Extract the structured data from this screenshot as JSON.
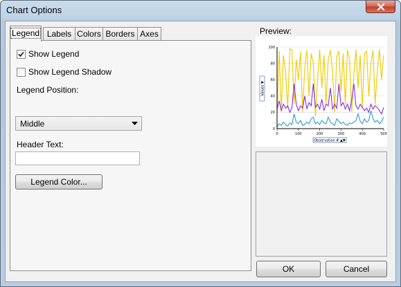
{
  "window": {
    "title": "Chart Options"
  },
  "tabs": [
    {
      "label": "Legend",
      "active": true
    },
    {
      "label": "Labels",
      "active": false
    },
    {
      "label": "Colors",
      "active": false
    },
    {
      "label": "Borders",
      "active": false
    },
    {
      "label": "Axes",
      "active": false
    }
  ],
  "legend_panel": {
    "show_legend": {
      "label": "Show Legend",
      "checked": true
    },
    "show_legend_shadow": {
      "label": "Show Legend Shadow",
      "checked": false
    },
    "position_label": "Legend Position:",
    "position_value": "Middle",
    "header_label": "Header Text:",
    "header_value": "",
    "color_button": "Legend Color..."
  },
  "preview": {
    "label": "Preview:",
    "chart_data": {
      "type": "line",
      "title": "",
      "xlabel": "Observation #",
      "ylabel": "Values",
      "x_ticks": [
        "0",
        "100",
        "200",
        "300",
        "400",
        "500"
      ],
      "y_ticks": [
        "0",
        "20",
        "40",
        "60",
        "80",
        "100"
      ],
      "xlim": [
        0,
        500
      ],
      "ylim": [
        0,
        100
      ],
      "series": [
        {
          "color": "#f2cc0c",
          "values": [
            18,
            95,
            22,
            90,
            70,
            25,
            98,
            96,
            30,
            85,
            60,
            94,
            20,
            75,
            96,
            40,
            92,
            80,
            15,
            60,
            97,
            50,
            90,
            30,
            85,
            96,
            70,
            20,
            88,
            95,
            45,
            92,
            30,
            96,
            85,
            20,
            65,
            97,
            50,
            90,
            25,
            92,
            95,
            40,
            80,
            96,
            30,
            70,
            97,
            60,
            90
          ]
        },
        {
          "color": "#8a2be2",
          "values": [
            24,
            34,
            22,
            30,
            25,
            28,
            20,
            26,
            55,
            30,
            22,
            28,
            25,
            40,
            24,
            32,
            28,
            55,
            26,
            30,
            24,
            36,
            22,
            30,
            28,
            50,
            24,
            30,
            25,
            55,
            28,
            32,
            24,
            30,
            22,
            35,
            55,
            28,
            24,
            30,
            26,
            22,
            25,
            20,
            30,
            24,
            28,
            26,
            22,
            18,
            26
          ]
        },
        {
          "color": "#2f9bd6",
          "values": [
            2,
            6,
            4,
            8,
            5,
            3,
            7,
            5,
            18,
            8,
            6,
            10,
            4,
            5,
            8,
            6,
            12,
            14,
            6,
            8,
            5,
            10,
            7,
            6,
            14,
            8,
            6,
            4,
            12,
            9,
            6,
            8,
            5,
            4,
            7,
            6,
            8,
            10,
            18,
            9,
            6,
            12,
            8,
            10,
            22,
            12,
            8,
            10,
            6,
            9,
            14
          ]
        }
      ]
    }
  },
  "buttons": {
    "ok": "OK",
    "cancel": "Cancel"
  },
  "icons": {
    "close": "close-icon",
    "dropdown": "chevron-down-icon",
    "check": "check-icon"
  }
}
